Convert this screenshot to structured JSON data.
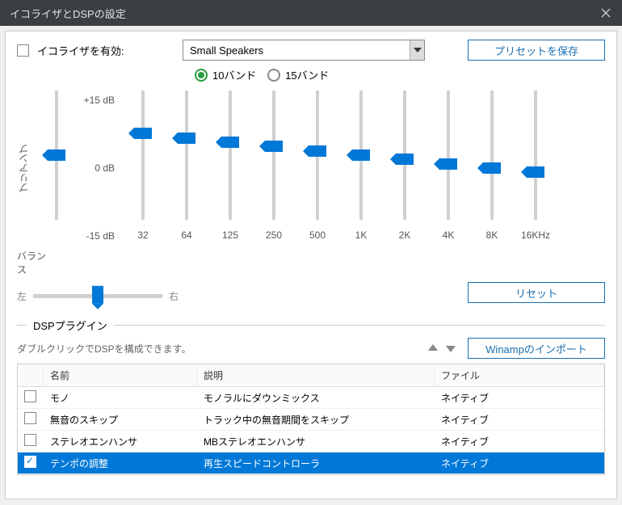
{
  "window": {
    "title": "イコライザとDSPの設定"
  },
  "equalizer": {
    "enable_label": "イコライザを有効:",
    "enabled": false,
    "preset": "Small Speakers",
    "save_preset_label": "プリセットを保存",
    "band10_label": "10バンド",
    "band15_label": "15バンド",
    "selected_band": "10",
    "gain_labels": {
      "top": "+15 dB",
      "mid": "0 dB",
      "bot": "-15 dB"
    },
    "preamp_label": "プリアンプ",
    "preamp_value": 0,
    "bands": [
      {
        "freq": "32",
        "value": 5.0
      },
      {
        "freq": "64",
        "value": 4.0
      },
      {
        "freq": "125",
        "value": 3.0
      },
      {
        "freq": "250",
        "value": 2.0
      },
      {
        "freq": "500",
        "value": 1.0
      },
      {
        "freq": "1K",
        "value": 0.0
      },
      {
        "freq": "2K",
        "value": -1.0
      },
      {
        "freq": "4K",
        "value": -2.0
      },
      {
        "freq": "8K",
        "value": -3.0
      },
      {
        "freq": "16KHz",
        "value": -4.0
      }
    ],
    "balance_label": "バランス",
    "balance_left": "左",
    "balance_right": "右",
    "balance_value": 0,
    "reset_label": "リセット"
  },
  "dsp": {
    "section_title": "DSPプラグイン",
    "hint": "ダブルクリックでDSPを構成できます。",
    "import_label": "Winampのインポート",
    "columns": {
      "name": "名前",
      "desc": "説明",
      "file": "ファイル"
    },
    "plugins": [
      {
        "enabled": false,
        "name": "モノ",
        "desc": "モノラルにダウンミックス",
        "file": "ネイティブ",
        "selected": false
      },
      {
        "enabled": false,
        "name": "無音のスキップ",
        "desc": "トラック中の無音期間をスキップ",
        "file": "ネイティブ",
        "selected": false
      },
      {
        "enabled": false,
        "name": "ステレオエンハンサ",
        "desc": "MBステレオエンハンサ",
        "file": "ネイティブ",
        "selected": false
      },
      {
        "enabled": true,
        "name": "テンポの調整",
        "desc": "再生スピードコントローラ",
        "file": "ネイティブ",
        "selected": true
      }
    ]
  }
}
